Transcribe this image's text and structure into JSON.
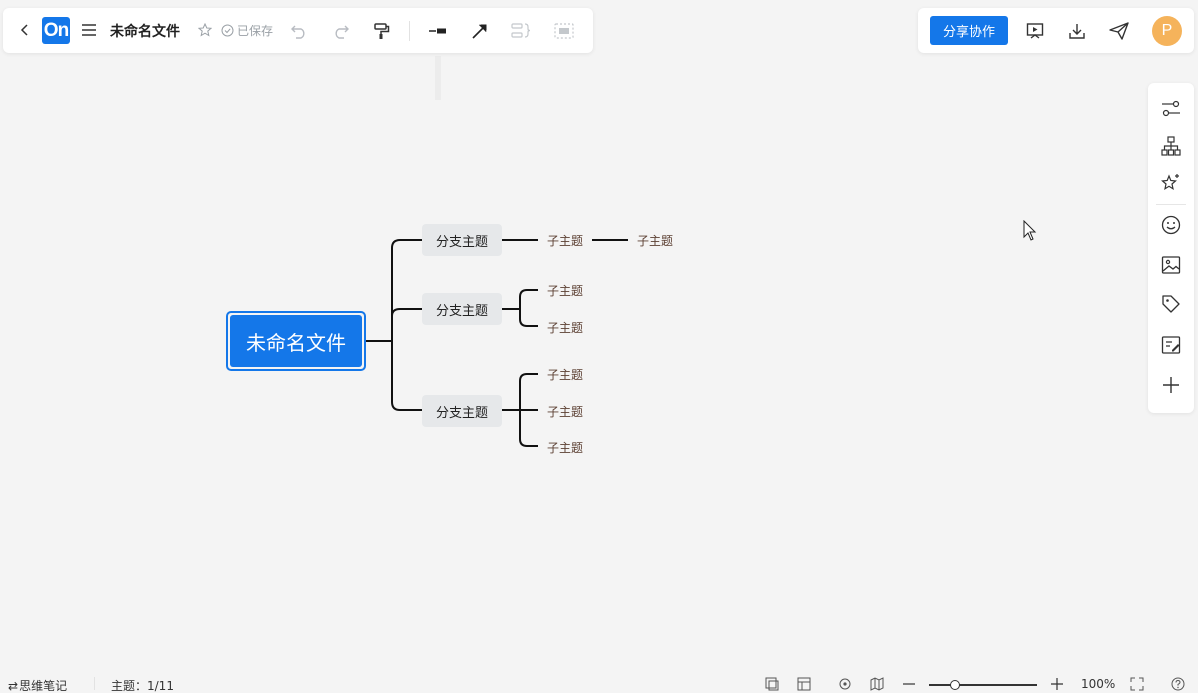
{
  "toolbar": {
    "logo_text": "On",
    "doc_title": "未命名文件",
    "saved_status": "已保存",
    "share_label": "分享协作",
    "avatar_initial": "P"
  },
  "mindmap": {
    "root": "未命名文件",
    "branches": [
      {
        "label": "分支主题",
        "children": [
          "子主题"
        ],
        "grandchild": "子主题"
      },
      {
        "label": "分支主题",
        "children": [
          "子主题",
          "子主题"
        ]
      },
      {
        "label": "分支主题",
        "children": [
          "子主题",
          "子主题",
          "子主题"
        ]
      }
    ]
  },
  "statusbar": {
    "notes_label": "思维笔记",
    "topic_count": "主题：1/11",
    "zoom": "100%"
  },
  "colors": {
    "accent": "#1477e9",
    "canvas_bg": "#f4f4f4",
    "branch_bg": "#e6e8ea",
    "avatar_bg": "#f5b35b"
  }
}
